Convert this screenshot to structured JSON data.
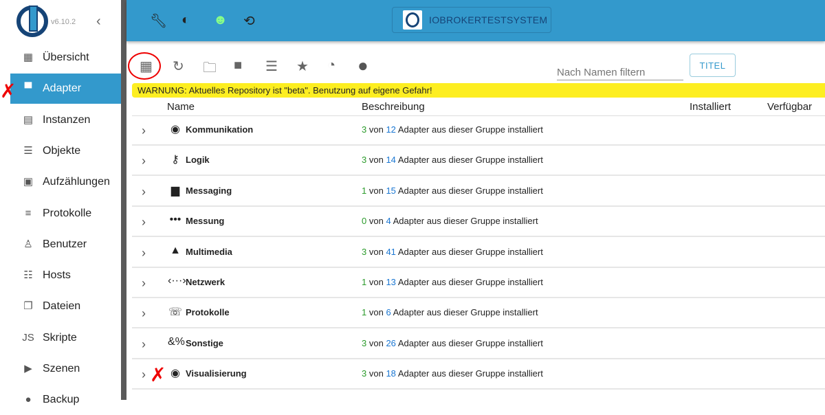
{
  "sidebar": {
    "version": "v6.10.2",
    "items": [
      {
        "label": "Übersicht",
        "icon": "grid-icon",
        "glyph": "▦"
      },
      {
        "label": "Adapter",
        "icon": "store-icon",
        "glyph": "▀"
      },
      {
        "label": "Instanzen",
        "icon": "instances-icon",
        "glyph": "▤"
      },
      {
        "label": "Objekte",
        "icon": "list-icon",
        "glyph": "☰"
      },
      {
        "label": "Aufzählungen",
        "icon": "enum-icon",
        "glyph": "▣"
      },
      {
        "label": "Protokolle",
        "icon": "log-icon",
        "glyph": "≡"
      },
      {
        "label": "Benutzer",
        "icon": "user-icon",
        "glyph": "♙"
      },
      {
        "label": "Hosts",
        "icon": "hosts-icon",
        "glyph": "☷"
      },
      {
        "label": "Dateien",
        "icon": "files-icon",
        "glyph": "❐"
      },
      {
        "label": "Skripte",
        "icon": "js-icon",
        "glyph": "JS"
      },
      {
        "label": "Szenen",
        "icon": "scenes-icon",
        "glyph": "▶"
      },
      {
        "label": "Backup",
        "icon": "backup-icon",
        "glyph": "●"
      }
    ]
  },
  "topbar": {
    "host": "IOBROKERTESTSYSTEM"
  },
  "toolbar": {
    "filter_placeholder": "Nach Namen filtern",
    "titel_label": "TITEL"
  },
  "warning": "WARNUNG: Aktuelles Repository ist \"beta\". Benutzung auf eigene Gefahr!",
  "table": {
    "headers": [
      "Name",
      "Beschreibung",
      "Installiert",
      "Verfügbar"
    ],
    "von": "von",
    "suffix": "Adapter aus dieser Gruppe installiert",
    "rows": [
      {
        "name": "Kommunikation",
        "icon": "podcast-icon",
        "glyph": "◉",
        "installed": "3",
        "total": "12"
      },
      {
        "name": "Logik",
        "icon": "key-icon",
        "glyph": "⚷",
        "installed": "3",
        "total": "14"
      },
      {
        "name": "Messaging",
        "icon": "message-icon",
        "glyph": "▆",
        "installed": "1",
        "total": "15"
      },
      {
        "name": "Messung",
        "icon": "timeline-icon",
        "glyph": "•••",
        "installed": "0",
        "total": "4"
      },
      {
        "name": "Multimedia",
        "icon": "photo-library-icon",
        "glyph": "▲",
        "installed": "3",
        "total": "41"
      },
      {
        "name": "Netzwerk",
        "icon": "network-icon",
        "glyph": "‹···›",
        "installed": "1",
        "total": "13"
      },
      {
        "name": "Protokolle",
        "icon": "sip-phone-icon",
        "glyph": "☏",
        "installed": "1",
        "total": "6"
      },
      {
        "name": "Sonstige",
        "icon": "misc-symbols-icon",
        "glyph": "&%",
        "installed": "3",
        "total": "26"
      },
      {
        "name": "Visualisierung",
        "icon": "eye-icon",
        "glyph": "◉",
        "installed": "3",
        "total": "18"
      }
    ]
  }
}
